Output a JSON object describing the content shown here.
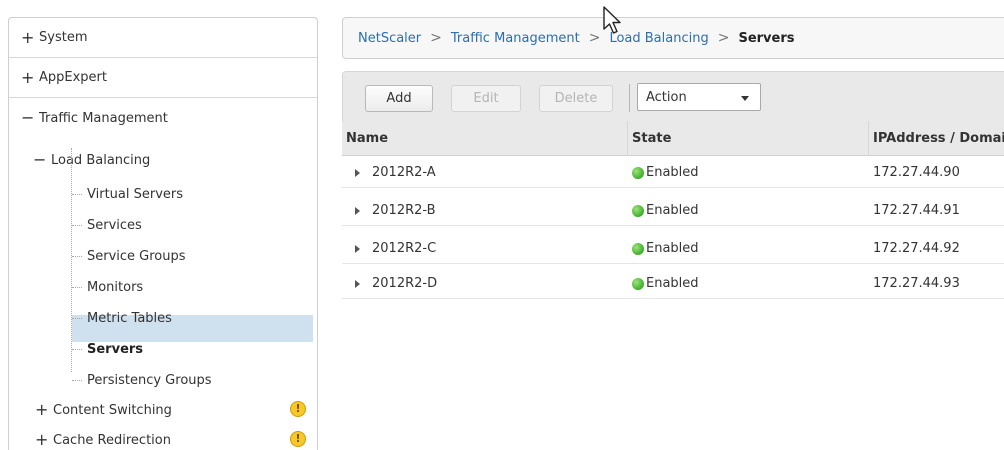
{
  "nav": {
    "top_items": [
      {
        "symbol": "+",
        "label": "System"
      },
      {
        "symbol": "+",
        "label": "AppExpert"
      },
      {
        "symbol": "−",
        "label": "Traffic Management"
      }
    ],
    "load_balancing": {
      "symbol": "−",
      "label": "Load Balancing"
    },
    "children": [
      {
        "label": "Virtual Servers"
      },
      {
        "label": "Services"
      },
      {
        "label": "Service Groups"
      },
      {
        "label": "Monitors"
      },
      {
        "label": "Metric Tables"
      },
      {
        "label": "Servers",
        "selected": true
      },
      {
        "label": "Persistency Groups"
      }
    ],
    "content_switching": {
      "symbol": "+",
      "label": "Content Switching",
      "warning": "!"
    },
    "cache_redirection": {
      "symbol": "+",
      "label": "Cache Redirection",
      "warning": "!"
    }
  },
  "breadcrumb": {
    "items": [
      "NetScaler",
      "Traffic Management",
      "Load Balancing"
    ],
    "separator": ">",
    "current": "Servers"
  },
  "toolbar": {
    "add_label": "Add",
    "edit_label": "Edit",
    "delete_label": "Delete",
    "action_label": "Action"
  },
  "table": {
    "headers": [
      "Name",
      "State",
      "IPAddress / Domai"
    ],
    "rows": [
      {
        "name": "2012R2-A",
        "state": "Enabled",
        "ip": "172.27.44.90"
      },
      {
        "name": "2012R2-B",
        "state": "Enabled",
        "ip": "172.27.44.91"
      },
      {
        "name": "2012R2-C",
        "state": "Enabled",
        "ip": "172.27.44.92"
      },
      {
        "name": "2012R2-D",
        "state": "Enabled",
        "ip": "172.27.44.93"
      }
    ]
  },
  "colors": {
    "link": "#2a6fb0",
    "selected_row": "#cfe1ef",
    "enabled_dot": "#3fae2a",
    "warning": "#f7c928",
    "header_bg": "#e9e9e9"
  }
}
